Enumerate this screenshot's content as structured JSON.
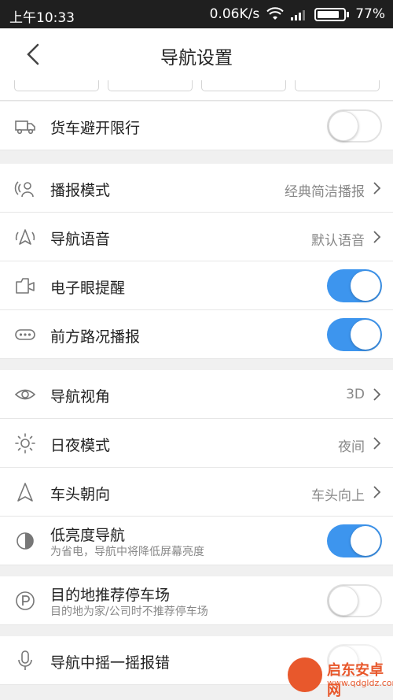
{
  "status_bar": {
    "time": "上午10:33",
    "network_speed": "0.06K/s",
    "battery": "77%"
  },
  "header": {
    "title": "导航设置"
  },
  "rows": {
    "truck": {
      "label": "货车避开限行",
      "enabled": false
    },
    "broadcast_mode": {
      "label": "播报模式",
      "value": "经典简洁播报"
    },
    "voice": {
      "label": "导航语音",
      "value": "默认语音"
    },
    "camera_alert": {
      "label": "电子眼提醒",
      "enabled": true
    },
    "traffic_ahead": {
      "label": "前方路况播报",
      "enabled": true
    },
    "view_angle": {
      "label": "导航视角",
      "value": "3D"
    },
    "day_night": {
      "label": "日夜模式",
      "value": "夜间"
    },
    "heading": {
      "label": "车头朝向",
      "value": "车头向上"
    },
    "low_brightness": {
      "label": "低亮度导航",
      "sub": "为省电，导航中将降低屏幕亮度",
      "enabled": true
    },
    "parking": {
      "label": "目的地推荐停车场",
      "sub": "目的地为家/公司时不推荐停车场",
      "enabled": false
    },
    "shake_report": {
      "label": "导航中摇一摇报错",
      "enabled": false
    }
  },
  "watermark": {
    "title": "启东安卓网",
    "url": "www.qdgldz.com"
  },
  "colors": {
    "toggle_on": "#3d95ee",
    "accent_watermark": "#e8582c"
  }
}
